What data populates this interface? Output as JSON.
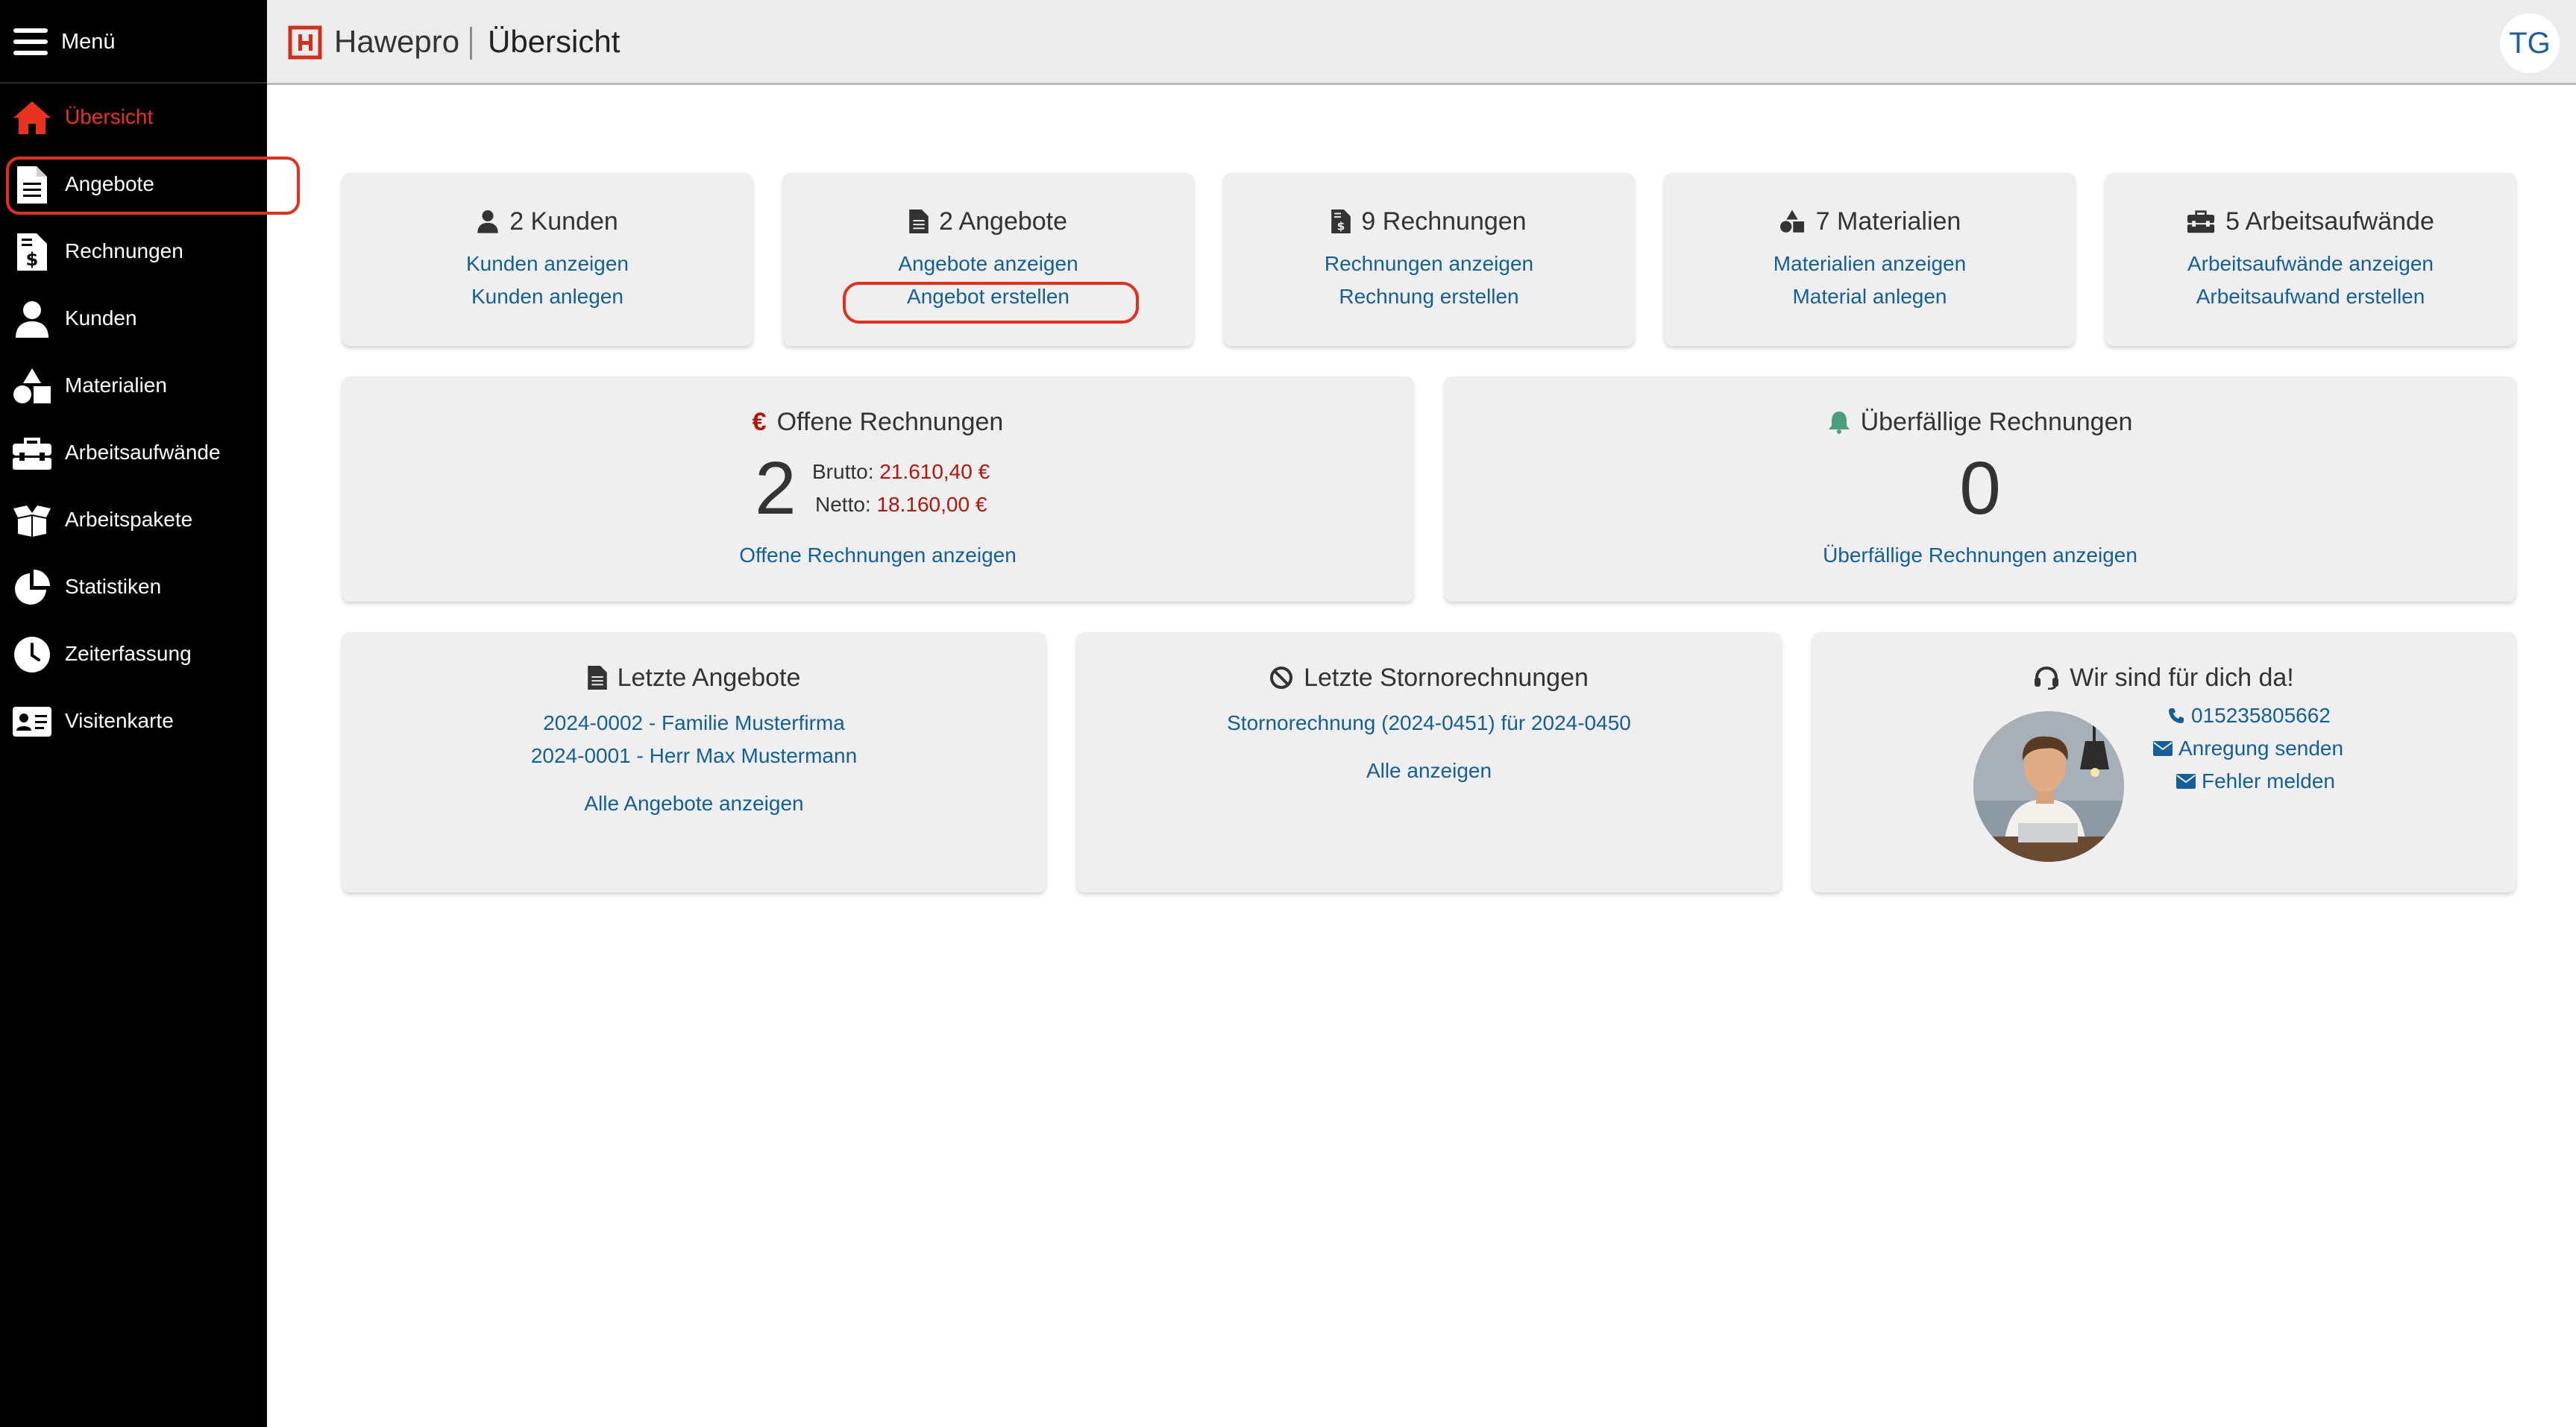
{
  "sidebar": {
    "menu_label": "Menü",
    "items": [
      {
        "label": "Übersicht",
        "icon": "home-icon",
        "active": true
      },
      {
        "label": "Angebote",
        "icon": "document-icon",
        "active": false
      },
      {
        "label": "Rechnungen",
        "icon": "invoice-icon",
        "active": false
      },
      {
        "label": "Kunden",
        "icon": "user-icon",
        "active": false
      },
      {
        "label": "Materialien",
        "icon": "shapes-icon",
        "active": false
      },
      {
        "label": "Arbeitsaufwände",
        "icon": "toolbox-icon",
        "active": false
      },
      {
        "label": "Arbeitspakete",
        "icon": "box-open-icon",
        "active": false
      },
      {
        "label": "Statistiken",
        "icon": "pie-chart-icon",
        "active": false
      },
      {
        "label": "Zeiterfassung",
        "icon": "clock-icon",
        "active": false
      },
      {
        "label": "Visitenkarte",
        "icon": "id-card-icon",
        "active": false
      }
    ]
  },
  "header": {
    "brand": "Hawepro",
    "page_title": "Übersicht",
    "avatar_initials": "TG"
  },
  "stats": [
    {
      "title": "2 Kunden",
      "icon": "user-icon",
      "link1": "Kunden anzeigen",
      "link2": "Kunden anlegen"
    },
    {
      "title": "2 Angebote",
      "icon": "document-icon",
      "link1": "Angebote anzeigen",
      "link2": "Angebot erstellen"
    },
    {
      "title": "9 Rechnungen",
      "icon": "invoice-icon",
      "link1": "Rechnungen anzeigen",
      "link2": "Rechnung erstellen"
    },
    {
      "title": "7 Materialien",
      "icon": "shapes-icon",
      "link1": "Materialien anzeigen",
      "link2": "Material anlegen"
    },
    {
      "title": "5 Arbeitsaufwände",
      "icon": "toolbox-icon",
      "link1": "Arbeitsaufwände anzeigen",
      "link2": "Arbeitsaufwand erstellen"
    }
  ],
  "open_invoices": {
    "currency_symbol": "€",
    "title": "Offene Rechnungen",
    "count": "2",
    "brutto_label": "Brutto:",
    "brutto_value": "21.610,40 €",
    "netto_label": "Netto:",
    "netto_value": "18.160,00 €",
    "link": "Offene Rechnungen anzeigen"
  },
  "overdue_invoices": {
    "title": "Überfällige Rechnungen",
    "count": "0",
    "link": "Überfällige Rechnungen anzeigen"
  },
  "recent_offers": {
    "title": "Letzte Angebote",
    "items": [
      "2024-0002 - Familie Musterfirma",
      "2024-0001 - Herr Max Mustermann"
    ],
    "link": "Alle Angebote anzeigen"
  },
  "recent_cancellations": {
    "title": "Letzte Stornorechnungen",
    "items": [
      "Stornorechnung (2024-0451) für 2024-0450"
    ],
    "link": "Alle anzeigen"
  },
  "support": {
    "title": "Wir sind für dich da!",
    "phone": "015235805662",
    "feedback": "Anregung senden",
    "report_bug": "Fehler melden"
  },
  "colors": {
    "accent_red": "#e8321f",
    "link_blue": "#145f9a",
    "money_red": "#b3170c",
    "sidebar_bg": "#000000",
    "card_bg": "#efefef",
    "bell_green": "#4a9e7e"
  }
}
